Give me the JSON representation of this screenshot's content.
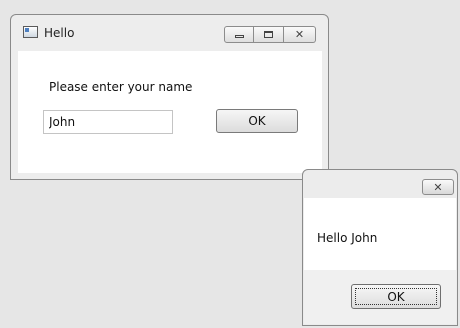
{
  "main_window": {
    "title": "Hello",
    "title_icon": "app-window-icon",
    "caption_buttons": {
      "minimize_icon": "minimize-icon",
      "maximize_icon": "maximize-icon",
      "close_icon": "close-icon",
      "close_glyph": "✕"
    },
    "prompt_label": "Please enter your name",
    "name_input": {
      "value": "John",
      "placeholder": ""
    },
    "ok_label": "OK"
  },
  "message_box": {
    "title": "",
    "close_glyph": "✕",
    "message": "Hello John",
    "ok_label": "OK"
  },
  "colors": {
    "desktop_background": "#e6e6e6",
    "window_frame": "#ededed",
    "client_area": "#ffffff"
  }
}
